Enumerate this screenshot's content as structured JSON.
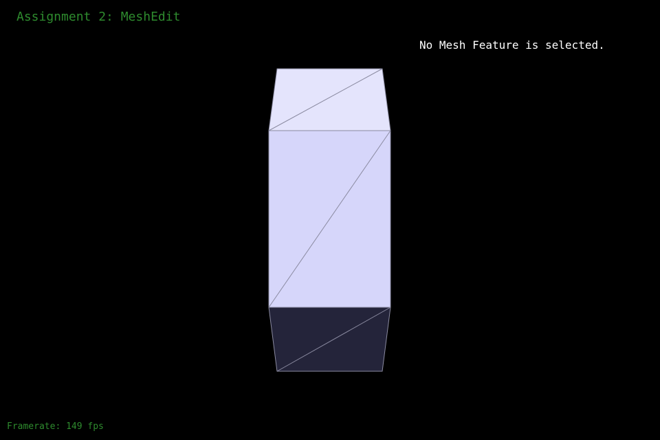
{
  "app": {
    "title": "Assignment 2: MeshEdit"
  },
  "status": {
    "selection_text": "No Mesh Feature is selected."
  },
  "stats": {
    "framerate_text": "Framerate: 149 fps"
  },
  "colors": {
    "background": "#000000",
    "title_text": "#2e8b2e",
    "status_text": "#ffffff",
    "framerate_text": "#2e8b2e",
    "face_top": "#e4e4fc",
    "face_front": "#d6d6fa",
    "face_bottom": "#24243a",
    "edge": "#8a8aa0"
  },
  "mesh": {
    "shape": "cube",
    "selected_feature": null
  }
}
